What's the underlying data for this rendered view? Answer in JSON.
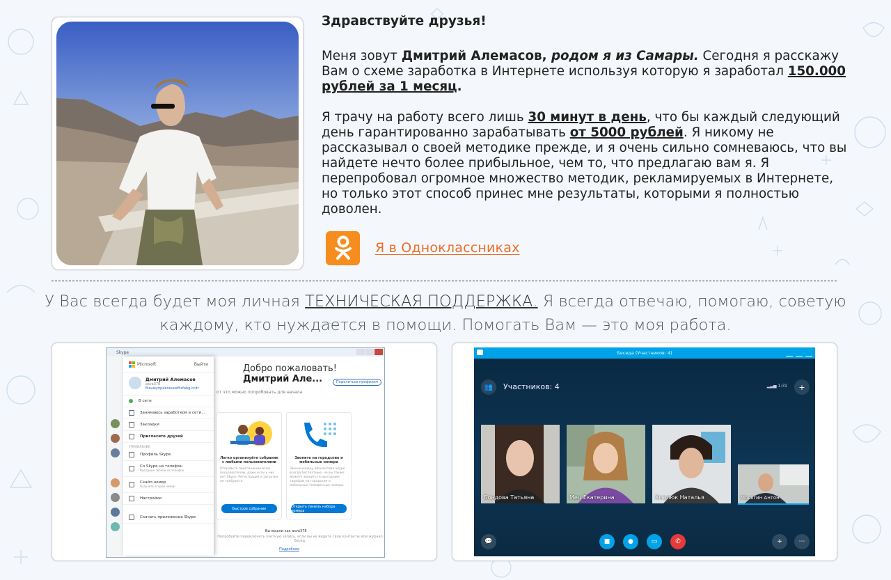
{
  "intro": {
    "greeting": "Здравствуйте друзья!",
    "p1_a": "Меня зовут ",
    "p1_name": "Дмитрий Алемасов,",
    "p1_origin": " родом я из Самары.",
    "p1_b": " Сегодня я расскажу Вам о схеме заработка в Интернете используя которую я заработал ",
    "p1_amount": "150.000 рублей за 1 месяц",
    "p1_end": ".",
    "p2_a": "Я трачу на работу всего лишь ",
    "p2_time": "30 минут в день",
    "p2_b": ", что бы каждый следующий день гарантированно зарабатывать ",
    "p2_amount": "от 5000 рублей",
    "p2_c": ". Я никому не рассказывал о своей методике прежде, и я очень сильно сомневаюсь, что вы найдете нечто более прибыльное, чем то, что предлагаю вам я. Я перепробовал огромное множество методик, рекламируемых в Интернете, но только этот способ принес мне результаты, которыми я полностью доволен.",
    "ok_link": "Я в Одноклассниках"
  },
  "support": {
    "a": "У Вас всегда будет моя личная ",
    "highlight": "ТЕХНИЧЕСКАЯ ПОДДЕРЖКА.",
    "b": "  Я всегда отвечаю, помогаю, советую каждому, кто нуждается в помощи. Помогать Вам — это моя работа."
  },
  "skype1": {
    "title": "Skype",
    "ms_label": "Microsoft",
    "logout": "Выйти",
    "user_name": "Дмитрий Алемасов",
    "user_id": "asva378",
    "user_link": "МенюуправлениеMsfabg.ccdr",
    "status": "В сети",
    "mood": "Занимаюсь заработком в сети...",
    "bookmarks": "Закладки",
    "invite": "Пригласите друзей",
    "section": "УПРАВЛЕНИЕ",
    "profile": "Профиль Skype",
    "to_phone": "Со Skype на телефон",
    "to_phone_sub": "Выгодные звонки на телефон",
    "skype_number": "Скайп-номер",
    "skype_number_sub": "Получить второй номер",
    "settings": "Настройки",
    "download": "Скачать приложение Skype",
    "welcome": "Добро пожаловать!",
    "welcome_name": "Дмитрий Але...",
    "share_profile": "Поделиться профилем",
    "try_text": "от что можно попробовать для начала",
    "card1_title": "Легко организуйте собрание с любыми пользователями",
    "card1_desc": "Отправьте приглашение всем пользователям, даже если у них нет Skype. Регистрация и загрузка не требуются.",
    "card1_btn": "Быстрое собрание",
    "card2_title": "Звоните на городские и мобильные номера",
    "card2_desc": "Звонки между абонентами Skype всегда бесплатные, но вы также можете звонить по выгодным тарифам на городские и мобильные телефонные номера.",
    "card2_btn": "Открыть панель набора номера",
    "signed_in": "Вы вошли как asva378",
    "foot": "Попробуйте переключить учетную запись, если вы не видите свои контакты или журнал бесед.",
    "more": "Подробнее"
  },
  "skype2": {
    "title": "Беседа (Участников: 4)",
    "participants": "Участников: 4",
    "time": "1:31",
    "people": [
      {
        "name": "Бондова Татьяна"
      },
      {
        "name": "Мец Екатерина"
      },
      {
        "name": "Хмелюк Наталья"
      },
      {
        "name": "Мосягин Антон"
      }
    ],
    "colors": {
      "accent": "#00a2e8",
      "hangup": "#e43a3a"
    }
  },
  "colors": {
    "ok_orange": "#f68d1e",
    "link_orange": "#ee6e2a"
  }
}
